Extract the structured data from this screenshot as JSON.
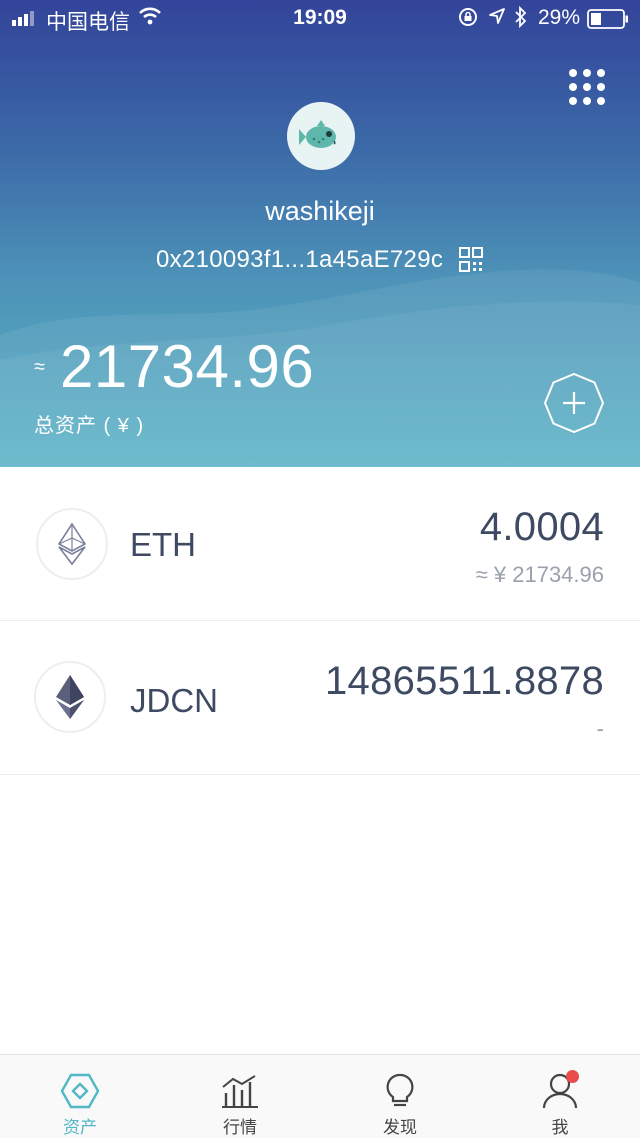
{
  "status_bar": {
    "carrier": "中国电信",
    "time": "19:09",
    "battery": "29%"
  },
  "wallet": {
    "name": "washikeji",
    "address": "0x210093f1...1a45aE729c",
    "approx_symbol": "≈",
    "total_value": "21734.96",
    "total_label": "总资产 ( ¥ )"
  },
  "tokens": [
    {
      "symbol": "ETH",
      "amount": "4.0004",
      "fiat": "≈  ¥  21734.96"
    },
    {
      "symbol": "JDCN",
      "amount": "14865511.8878",
      "fiat": "-"
    }
  ],
  "tabs": [
    {
      "label": "资产",
      "active": true
    },
    {
      "label": "行情",
      "active": false
    },
    {
      "label": "发现",
      "active": false
    },
    {
      "label": "我",
      "active": false
    }
  ],
  "colors": {
    "header_top": "#33449a",
    "header_bottom": "#5ab3c6",
    "accent": "#51b7c5",
    "text_primary": "#3d4a62",
    "badge": "#e94b4b"
  }
}
